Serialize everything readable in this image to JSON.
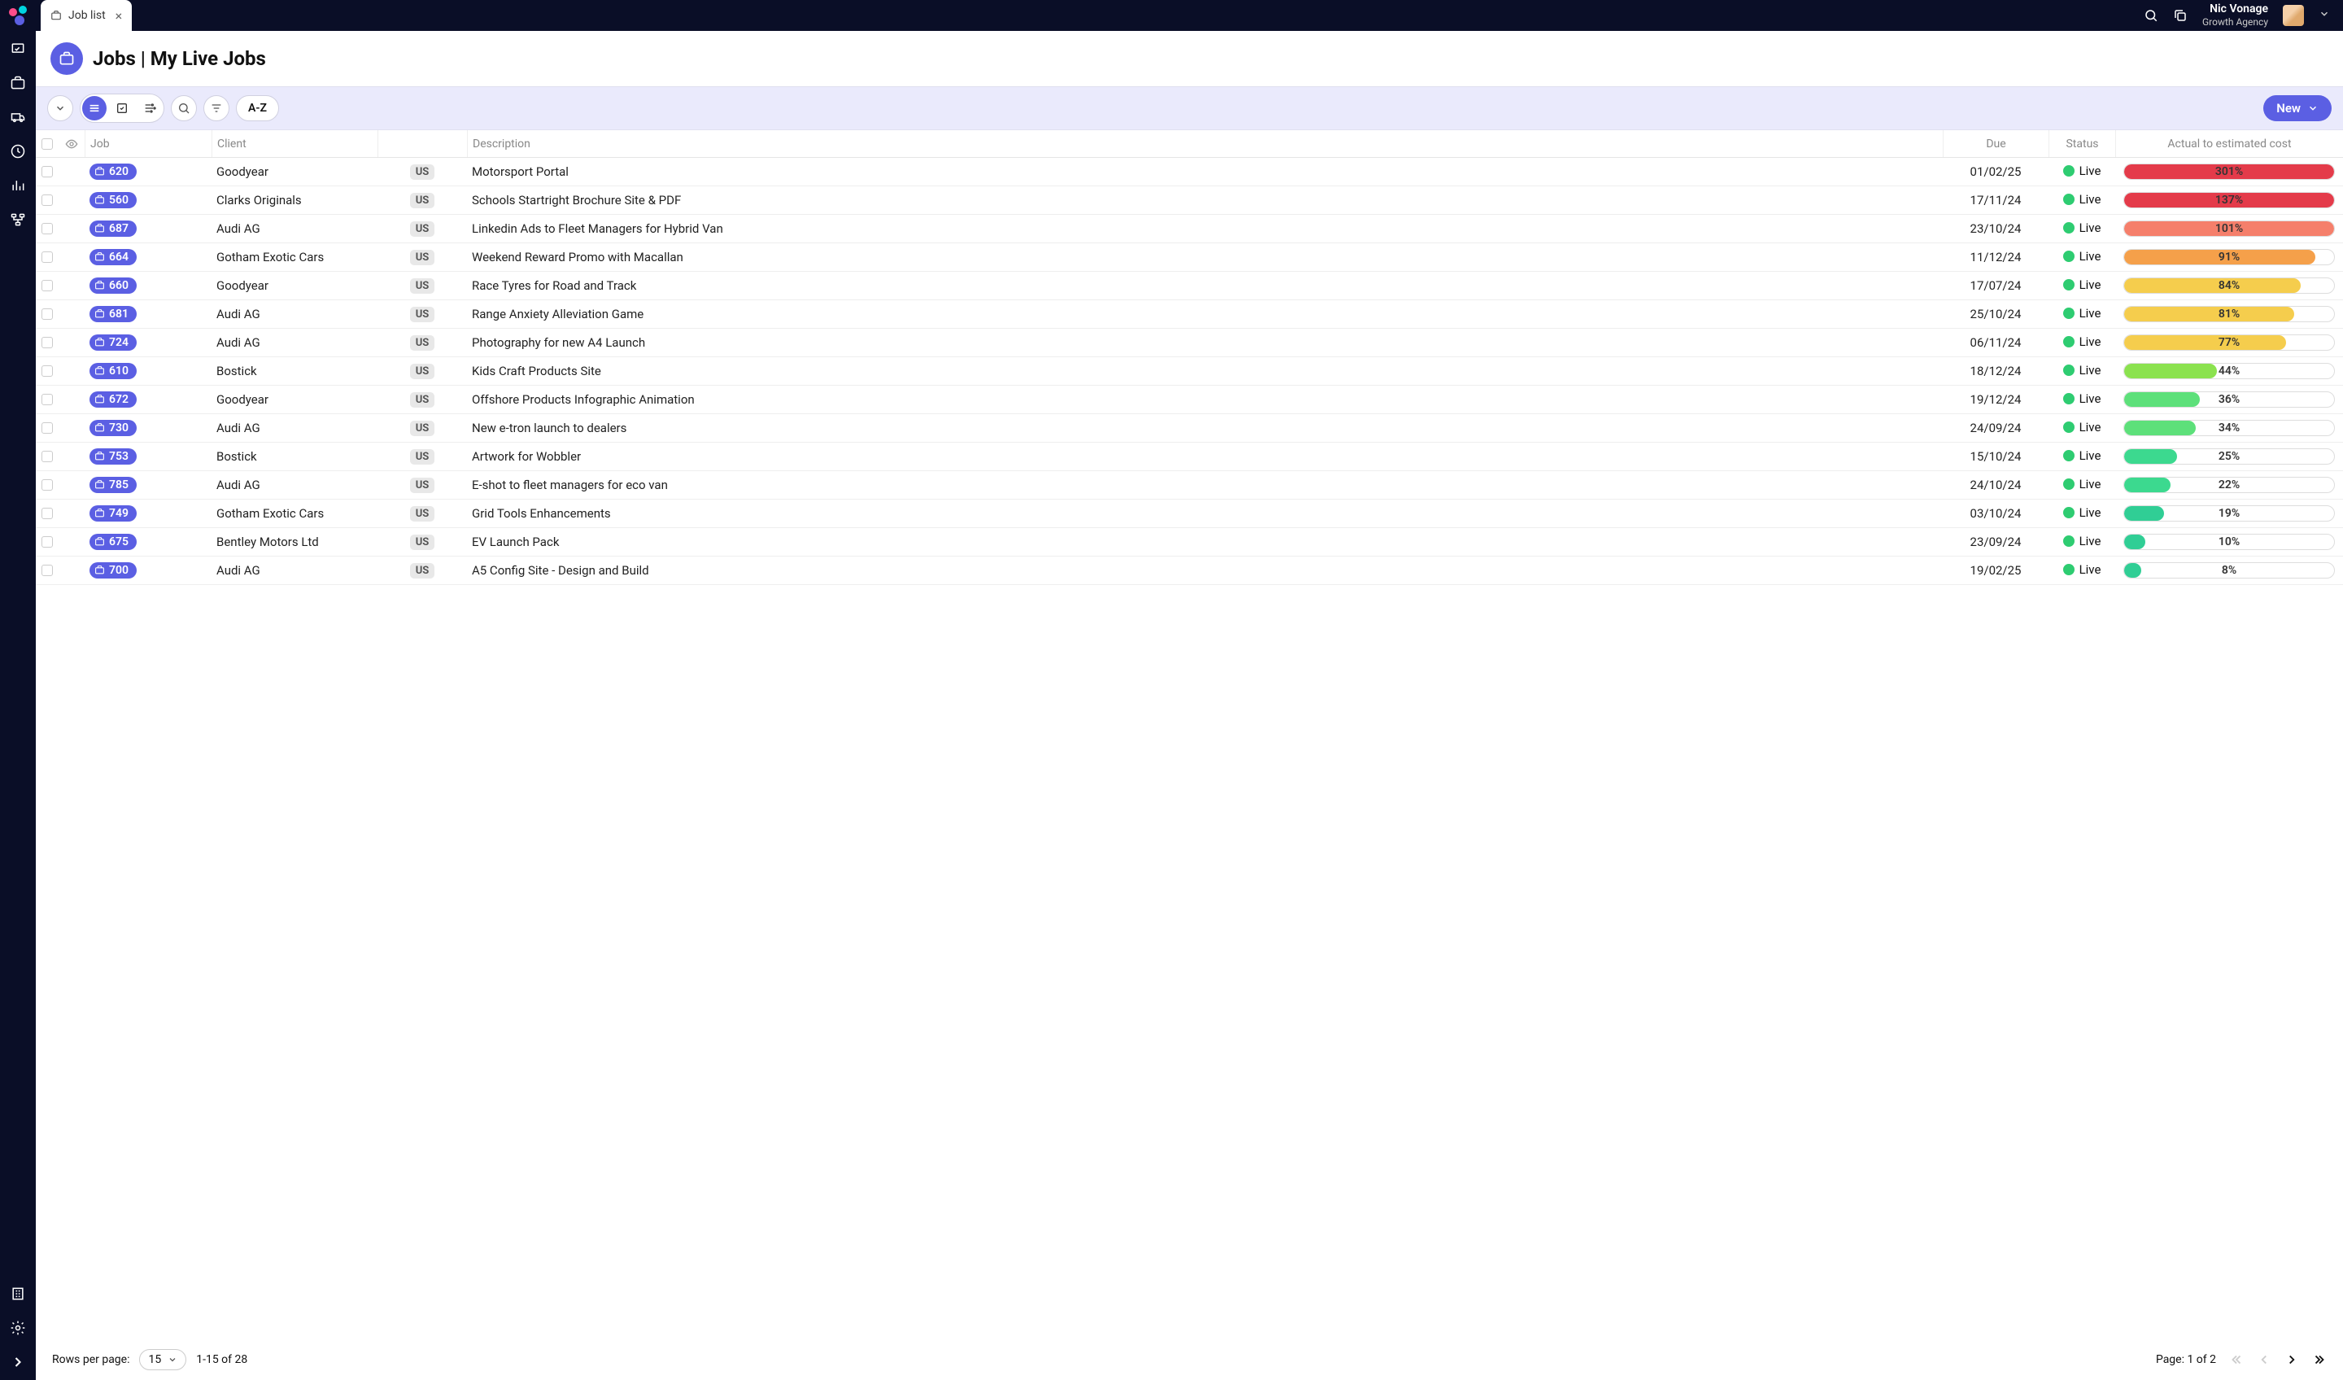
{
  "tab": {
    "label": "Job list"
  },
  "user": {
    "name": "Nic Vonage",
    "org": "Growth Agency"
  },
  "page": {
    "title": "Jobs | My Live Jobs"
  },
  "toolbar": {
    "sort": "A-Z",
    "new": "New"
  },
  "columns": {
    "job": "Job",
    "client": "Client",
    "description": "Description",
    "due": "Due",
    "status": "Status",
    "cost": "Actual to estimated cost"
  },
  "rows": [
    {
      "job": "620",
      "client": "Goodyear",
      "badge": "US",
      "desc": "Motorsport Portal",
      "due": "01/02/25",
      "status": "Live",
      "pct": 301,
      "color": "#e43b4a"
    },
    {
      "job": "560",
      "client": "Clarks Originals",
      "badge": "US",
      "desc": "Schools Startright Brochure Site & PDF",
      "due": "17/11/24",
      "status": "Live",
      "pct": 137,
      "color": "#e43b4a"
    },
    {
      "job": "687",
      "client": "Audi AG",
      "badge": "US",
      "desc": "Linkedin Ads to Fleet Managers for Hybrid Van",
      "due": "23/10/24",
      "status": "Live",
      "pct": 101,
      "color": "#f57f6b"
    },
    {
      "job": "664",
      "client": "Gotham Exotic Cars",
      "badge": "US",
      "desc": "Weekend Reward Promo with Macallan",
      "due": "11/12/24",
      "status": "Live",
      "pct": 91,
      "color": "#f5a04a"
    },
    {
      "job": "660",
      "client": "Goodyear",
      "badge": "US",
      "desc": "Race Tyres for Road and Track",
      "due": "17/07/24",
      "status": "Live",
      "pct": 84,
      "color": "#f5cd4d"
    },
    {
      "job": "681",
      "client": "Audi AG",
      "badge": "US",
      "desc": "Range Anxiety Alleviation Game",
      "due": "25/10/24",
      "status": "Live",
      "pct": 81,
      "color": "#f5cd4d"
    },
    {
      "job": "724",
      "client": "Audi AG",
      "badge": "US",
      "desc": "Photography for new A4 Launch",
      "due": "06/11/24",
      "status": "Live",
      "pct": 77,
      "color": "#f5cd4d"
    },
    {
      "job": "610",
      "client": "Bostick",
      "badge": "US",
      "desc": "Kids Craft Products Site",
      "due": "18/12/24",
      "status": "Live",
      "pct": 44,
      "color": "#8be24f"
    },
    {
      "job": "672",
      "client": "Goodyear",
      "badge": "US",
      "desc": "Offshore Products Infographic Animation",
      "due": "19/12/24",
      "status": "Live",
      "pct": 36,
      "color": "#5de07a"
    },
    {
      "job": "730",
      "client": "Audi AG",
      "badge": "US",
      "desc": "New e-tron launch to dealers",
      "due": "24/09/24",
      "status": "Live",
      "pct": 34,
      "color": "#5de07a"
    },
    {
      "job": "753",
      "client": "Bostick",
      "badge": "US",
      "desc": "Artwork for Wobbler",
      "due": "15/10/24",
      "status": "Live",
      "pct": 25,
      "color": "#3cd98f"
    },
    {
      "job": "785",
      "client": "Audi AG",
      "badge": "US",
      "desc": "E-shot to fleet managers for eco van",
      "due": "24/10/24",
      "status": "Live",
      "pct": 22,
      "color": "#3cd98f"
    },
    {
      "job": "749",
      "client": "Gotham Exotic Cars",
      "badge": "US",
      "desc": "Grid Tools Enhancements",
      "due": "03/10/24",
      "status": "Live",
      "pct": 19,
      "color": "#30ce95"
    },
    {
      "job": "675",
      "client": "Bentley Motors Ltd",
      "badge": "US",
      "desc": "EV Launch Pack",
      "due": "23/09/24",
      "status": "Live",
      "pct": 10,
      "color": "#30ce95"
    },
    {
      "job": "700",
      "client": "Audi AG",
      "badge": "US",
      "desc": "A5 Config Site - Design and Build",
      "due": "19/02/25",
      "status": "Live",
      "pct": 8,
      "color": "#30ce95"
    }
  ],
  "footer": {
    "rows_per_page_label": "Rows per page:",
    "page_size": "15",
    "range": "1-15 of 28",
    "page_info": "Page: 1 of 2"
  }
}
